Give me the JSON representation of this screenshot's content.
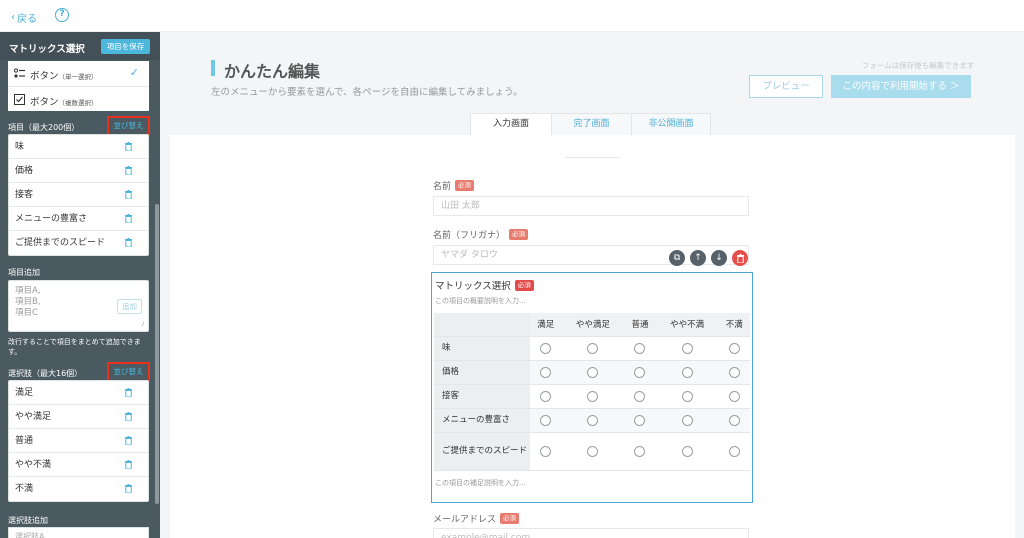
{
  "topbar": {
    "back_label": "戻る",
    "back_icon": "chevron-left-icon",
    "help_icon": "help-icon"
  },
  "sidebar": {
    "title": "マトリックス選択",
    "save_button": "項目を保存",
    "types": [
      {
        "label": "ボタン",
        "sub": "（単一選択）",
        "icon": "radio-list-icon",
        "selected": true
      },
      {
        "label": "ボタン",
        "sub": "（複数選択）",
        "icon": "checkbox-icon",
        "selected": false
      }
    ],
    "items_label": "項目（最大200個）",
    "items_sort": "並び替え",
    "items": [
      "味",
      "価格",
      "接客",
      "メニューの豊富さ",
      "ご提供までのスピード"
    ],
    "add_items_label": "項目追加",
    "add_items_placeholder_1": "項目A,",
    "add_items_placeholder_2": "項目B,",
    "add_items_placeholder_3": "項目C",
    "add_button": "追加",
    "add_note": "改行することで項目をまとめて追加できます。",
    "choices_label": "選択肢（最大16個）",
    "choices_sort": "並び替え",
    "choices": [
      "満足",
      "やや満足",
      "普通",
      "やや不満",
      "不満"
    ],
    "add_choices_label": "選択肢追加",
    "add_choices_placeholder": "選択肢A"
  },
  "main": {
    "title": "かんたん編集",
    "subtitle": "左のメニューから要素を選んで、各ページを自由に編集してみましょう。",
    "save_note": "フォームは保存後も編集できます",
    "preview_button": "プレビュー",
    "start_button": "この内容で利用開始する ＞",
    "tabs": [
      "入力画面",
      "完了画面",
      "非公開画面"
    ],
    "active_tab": 0
  },
  "form": {
    "required": "必須",
    "name_label": "名前",
    "name_placeholder": "山田 太郎",
    "kana_label": "名前（フリガナ）",
    "kana_placeholder": "ヤマダ タロウ",
    "matrix_title": "マトリックス選択",
    "matrix_desc": "この項目の概要説明を入力...",
    "matrix_foot": "この項目の補足説明を入力...",
    "matrix_columns": [
      "満足",
      "やや満足",
      "普通",
      "やや不満",
      "不満"
    ],
    "matrix_rows": [
      "味",
      "価格",
      "接客",
      "メニューの豊富さ",
      "ご提供までのスピード"
    ],
    "email_label": "メールアドレス",
    "email_placeholder": "example@mail.com"
  },
  "colors": {
    "accent": "#4cb6db",
    "sidebar_bg": "#4b5960",
    "highlight": "#e8321e",
    "required": "#e97b6e"
  }
}
